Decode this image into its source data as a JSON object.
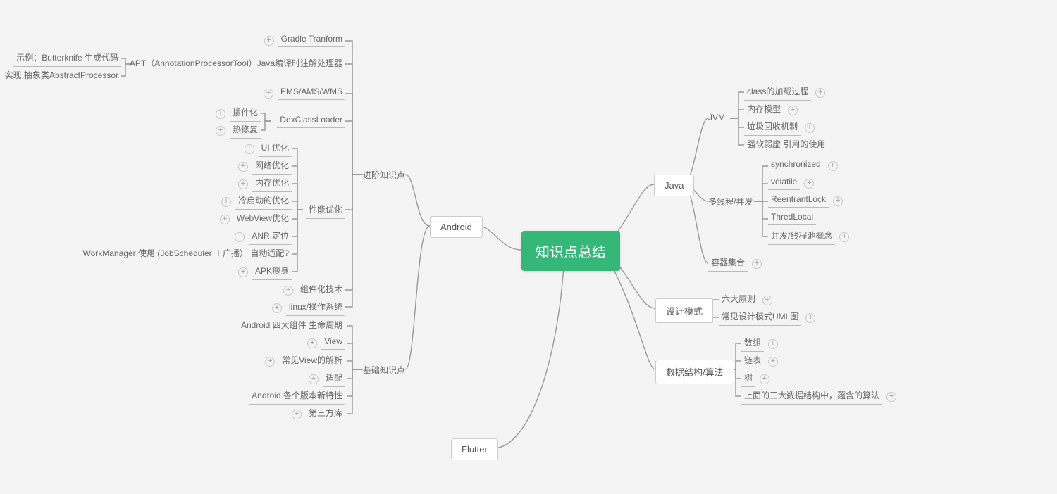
{
  "root": "知识点总结",
  "left": {
    "android": "Android",
    "flutter": "Flutter",
    "adv": "进阶知识点",
    "basic": "基础知识点",
    "gradle": "Gradle Tranform",
    "apt": "APT（AnnotationProcessorTool）Java编译时注解处理器",
    "apt1": "示例：Butterknife 生成代码",
    "apt2": "实现 抽象类AbstractProcessor",
    "pms": "PMS/AMS/WMS",
    "dex": "DexClassLoader",
    "dex1": "插件化",
    "dex2": "热修复",
    "perf": "性能优化",
    "p_ui": "UI 优化",
    "p_net": "网络优化",
    "p_mem": "内存优化",
    "p_cold": "冷启动的优化",
    "p_web": "WebView优化",
    "p_anr": "ANR 定位",
    "p_work": "WorkManager 使用 (JobScheduler ＋广播） 自动适配?",
    "p_apk": "APK瘦身",
    "modular": "组件化技术",
    "linuxos": "linux/操作系统",
    "b_comp": "Android 四大组件 生命周期",
    "b_view": "View",
    "b_cview": "常见View的解析",
    "b_fit": "适配",
    "b_ver": "Android  各个版本新特性",
    "b_lib": "第三方库"
  },
  "right": {
    "java": "Java",
    "pattern": "设计模式",
    "ds": "数据结构/算法",
    "jvm": "JVM",
    "jvm1": "class的加载过程",
    "jvm2": "内存模型",
    "jvm3": "垃圾回收机制",
    "jvm4": "强软弱虚 引用的使用",
    "thread": "多线程/并发",
    "t1": "synchronized",
    "t2": "volatile",
    "t3": "ReentrantLock",
    "t4": "ThredLocal",
    "t5": "并发/线程池概念",
    "coll": "容器集合",
    "pat1": "六大原则",
    "pat2": "常见设计模式UML图",
    "ds1": "数组",
    "ds2": "链表",
    "ds3": "树",
    "ds4": "上面的三大数据结构中，蕴含的算法"
  }
}
